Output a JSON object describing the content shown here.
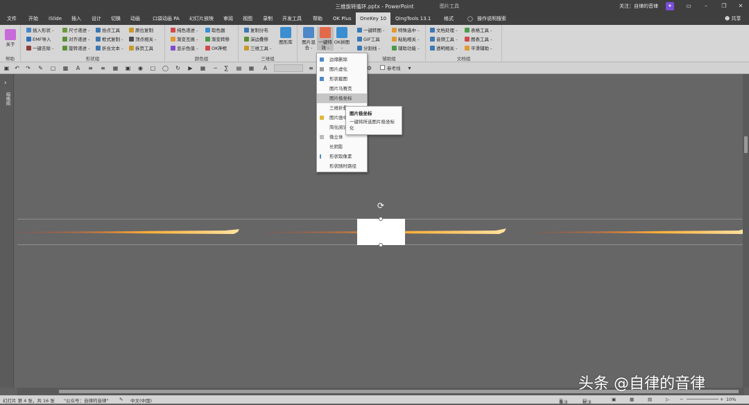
{
  "titlebar": {
    "document_title": "三维旋转循环.pptx - PowerPoint",
    "context_label": "图片工具",
    "follow_text": "关注：自律的音律"
  },
  "tabs": [
    "文件",
    "开始",
    "iSlide",
    "插入",
    "设计",
    "切换",
    "动画",
    "口袋动画 PA",
    "幻灯片放映",
    "审阅",
    "视图",
    "录制",
    "开发工具",
    "帮助",
    "OK Plus",
    "OneKey 10",
    "QingTools 13.1",
    "格式",
    "操作说明搜索"
  ],
  "share_label": "共享",
  "ribbon": {
    "about_label": "关于",
    "group_labels": [
      "帮助",
      "形状组",
      "颜色组",
      "三维组",
      "辅助组",
      "文档组"
    ],
    "shape_group": [
      "插入形状 -",
      "尺寸递进 -",
      "拾点工具",
      "原位复制",
      "EMF导入",
      "对齐递进 -",
      "框式复制 -",
      "顶点相关 -",
      "一键去除 -",
      "旋转递进 -",
      "折合文本 -",
      "拆页工具"
    ],
    "color_group": [
      "纯色递进 -",
      "取色器",
      "渐变互换 -",
      "渐变转移",
      "显示色值 -",
      "OK神框"
    ],
    "three_d_group": [
      "复制分布",
      "演边叠移",
      "三维工具 -"
    ],
    "big_buttons": [
      "图形库",
      "图片混合 -",
      "一键特效 -",
      "OK拼图 -"
    ],
    "assist_group": [
      "一键转图 -",
      "特殊选中 -",
      "GIF工具",
      "粘贴相关 -",
      "分割线 -",
      "辅助功能 -"
    ],
    "doc_group": [
      "文档处理 -",
      "表格工具 -",
      "音频工具 -",
      "图表工具 -",
      "透明相关 -",
      "平滑辅助 -"
    ]
  },
  "qat": {
    "ref_line_label": "参考线"
  },
  "leftpane": {
    "thumbnail_label": "缩略图"
  },
  "dropdown": {
    "items": [
      "边缘删除",
      "图片虚化",
      "形状截图",
      "图片马赛克",
      "图片极坐标",
      "三维折叠",
      "图片画中画",
      "简化阅读",
      "微立体",
      "长阴影",
      "形状取像素",
      "形状随时路径"
    ],
    "highlighted_index": 4
  },
  "tooltip": {
    "title": "图片极坐标",
    "body": "一键将所选图片极坐标化"
  },
  "statusbar": {
    "slide_info": "幻灯片 第 4 张，共 16 张",
    "theme": "\"公众号：自律的音律\"",
    "language": "中文(中国)",
    "notes": "备注",
    "comments": "批注",
    "zoom": "10%"
  },
  "watermark": "头条 @自律的音律",
  "colors": {
    "titlebar": "#3f3f3f",
    "ribbon": "#d6d6d6",
    "canvas": "#666666",
    "fire_core": "#ffb13a",
    "fire_edge": "#d8401a"
  }
}
